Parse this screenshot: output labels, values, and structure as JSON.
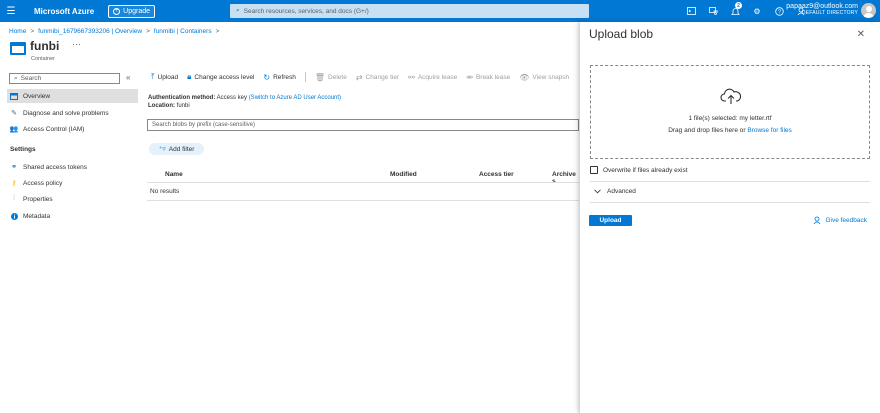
{
  "topbar": {
    "brand": "Microsoft Azure",
    "upgrade_label": "Upgrade",
    "search_placeholder": "Search resources, services, and docs (G+/)",
    "notification_count": "2",
    "account_email": "papaaz9@outlook.com",
    "account_directory": "DEFAULT DIRECTORY"
  },
  "breadcrumb": {
    "home": "Home",
    "account": "funmibi_1679667393206 | Overview",
    "containers": "funmibi | Containers"
  },
  "header": {
    "title": "funbi",
    "more": "···",
    "subtitle": "Container"
  },
  "sidebar": {
    "search_placeholder": "Search",
    "collapse": "«",
    "items": [
      {
        "label": "Overview"
      },
      {
        "label": "Diagnose and solve problems"
      },
      {
        "label": "Access Control (IAM)"
      }
    ],
    "settings_heading": "Settings",
    "settings_items": [
      {
        "label": "Shared access tokens"
      },
      {
        "label": "Access policy"
      },
      {
        "label": "Properties"
      },
      {
        "label": "Metadata"
      }
    ]
  },
  "toolbar": {
    "upload": "Upload",
    "change_access": "Change access level",
    "refresh": "Refresh",
    "delete": "Delete",
    "change_tier": "Change tier",
    "acquire_lease": "Acquire lease",
    "break_lease": "Break lease",
    "view_snapshots": "View snapsh"
  },
  "auth": {
    "method_label": "Authentication method:",
    "method_value": "Access key",
    "switch_link": "(Switch to Azure AD User Account)",
    "location_label": "Location:",
    "location_value": "funbi"
  },
  "blob_search_placeholder": "Search blobs by prefix (case-sensitive)",
  "add_filter": "Add filter",
  "table": {
    "columns": [
      "Name",
      "Modified",
      "Access tier",
      "Archive s"
    ],
    "empty": "No results"
  },
  "panel": {
    "title": "Upload blob",
    "close": "✕",
    "files_selected": "1 file(s) selected: my letter.rtf",
    "drag_drop": "Drag and drop files here",
    "or": "or",
    "browse": "Browse for files",
    "overwrite": "Overwrite if files already exist",
    "advanced": "Advanced",
    "upload_button": "Upload",
    "feedback": "Give feedback"
  }
}
